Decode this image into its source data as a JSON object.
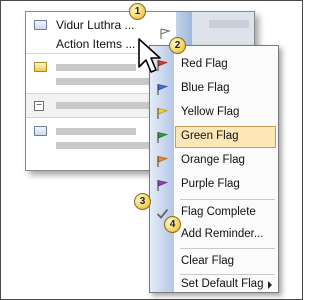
{
  "mail_list": {
    "selected_sender": "Vidur Luthra ...",
    "selected_subject": "Action Items ..."
  },
  "context_menu": {
    "items": [
      {
        "label": "Red Flag",
        "icon": "red-flag-icon",
        "color": "#d63a2a"
      },
      {
        "label": "Blue Flag",
        "icon": "blue-flag-icon",
        "color": "#3f6fd1"
      },
      {
        "label": "Yellow Flag",
        "icon": "yellow-flag-icon",
        "color": "#f2d22e"
      },
      {
        "label": "Green Flag",
        "icon": "green-flag-icon",
        "color": "#2e9e3a",
        "highlighted": true
      },
      {
        "label": "Orange Flag",
        "icon": "orange-flag-icon",
        "color": "#f08a1c"
      },
      {
        "label": "Purple Flag",
        "icon": "purple-flag-icon",
        "color": "#8a3fb8"
      },
      {
        "label": "Flag Complete",
        "icon": "checkmark-icon"
      },
      {
        "label": "Add Reminder...",
        "icon": ""
      },
      {
        "label": "Clear Flag",
        "icon": ""
      },
      {
        "label": "Set Default Flag",
        "icon": "",
        "submenu": true
      }
    ]
  },
  "callouts": [
    "1",
    "2",
    "3",
    "4"
  ],
  "colors": {
    "menu_highlight": "#fde7b6",
    "menu_strip": "#b3c6e6",
    "callout": "#f4d35e"
  }
}
